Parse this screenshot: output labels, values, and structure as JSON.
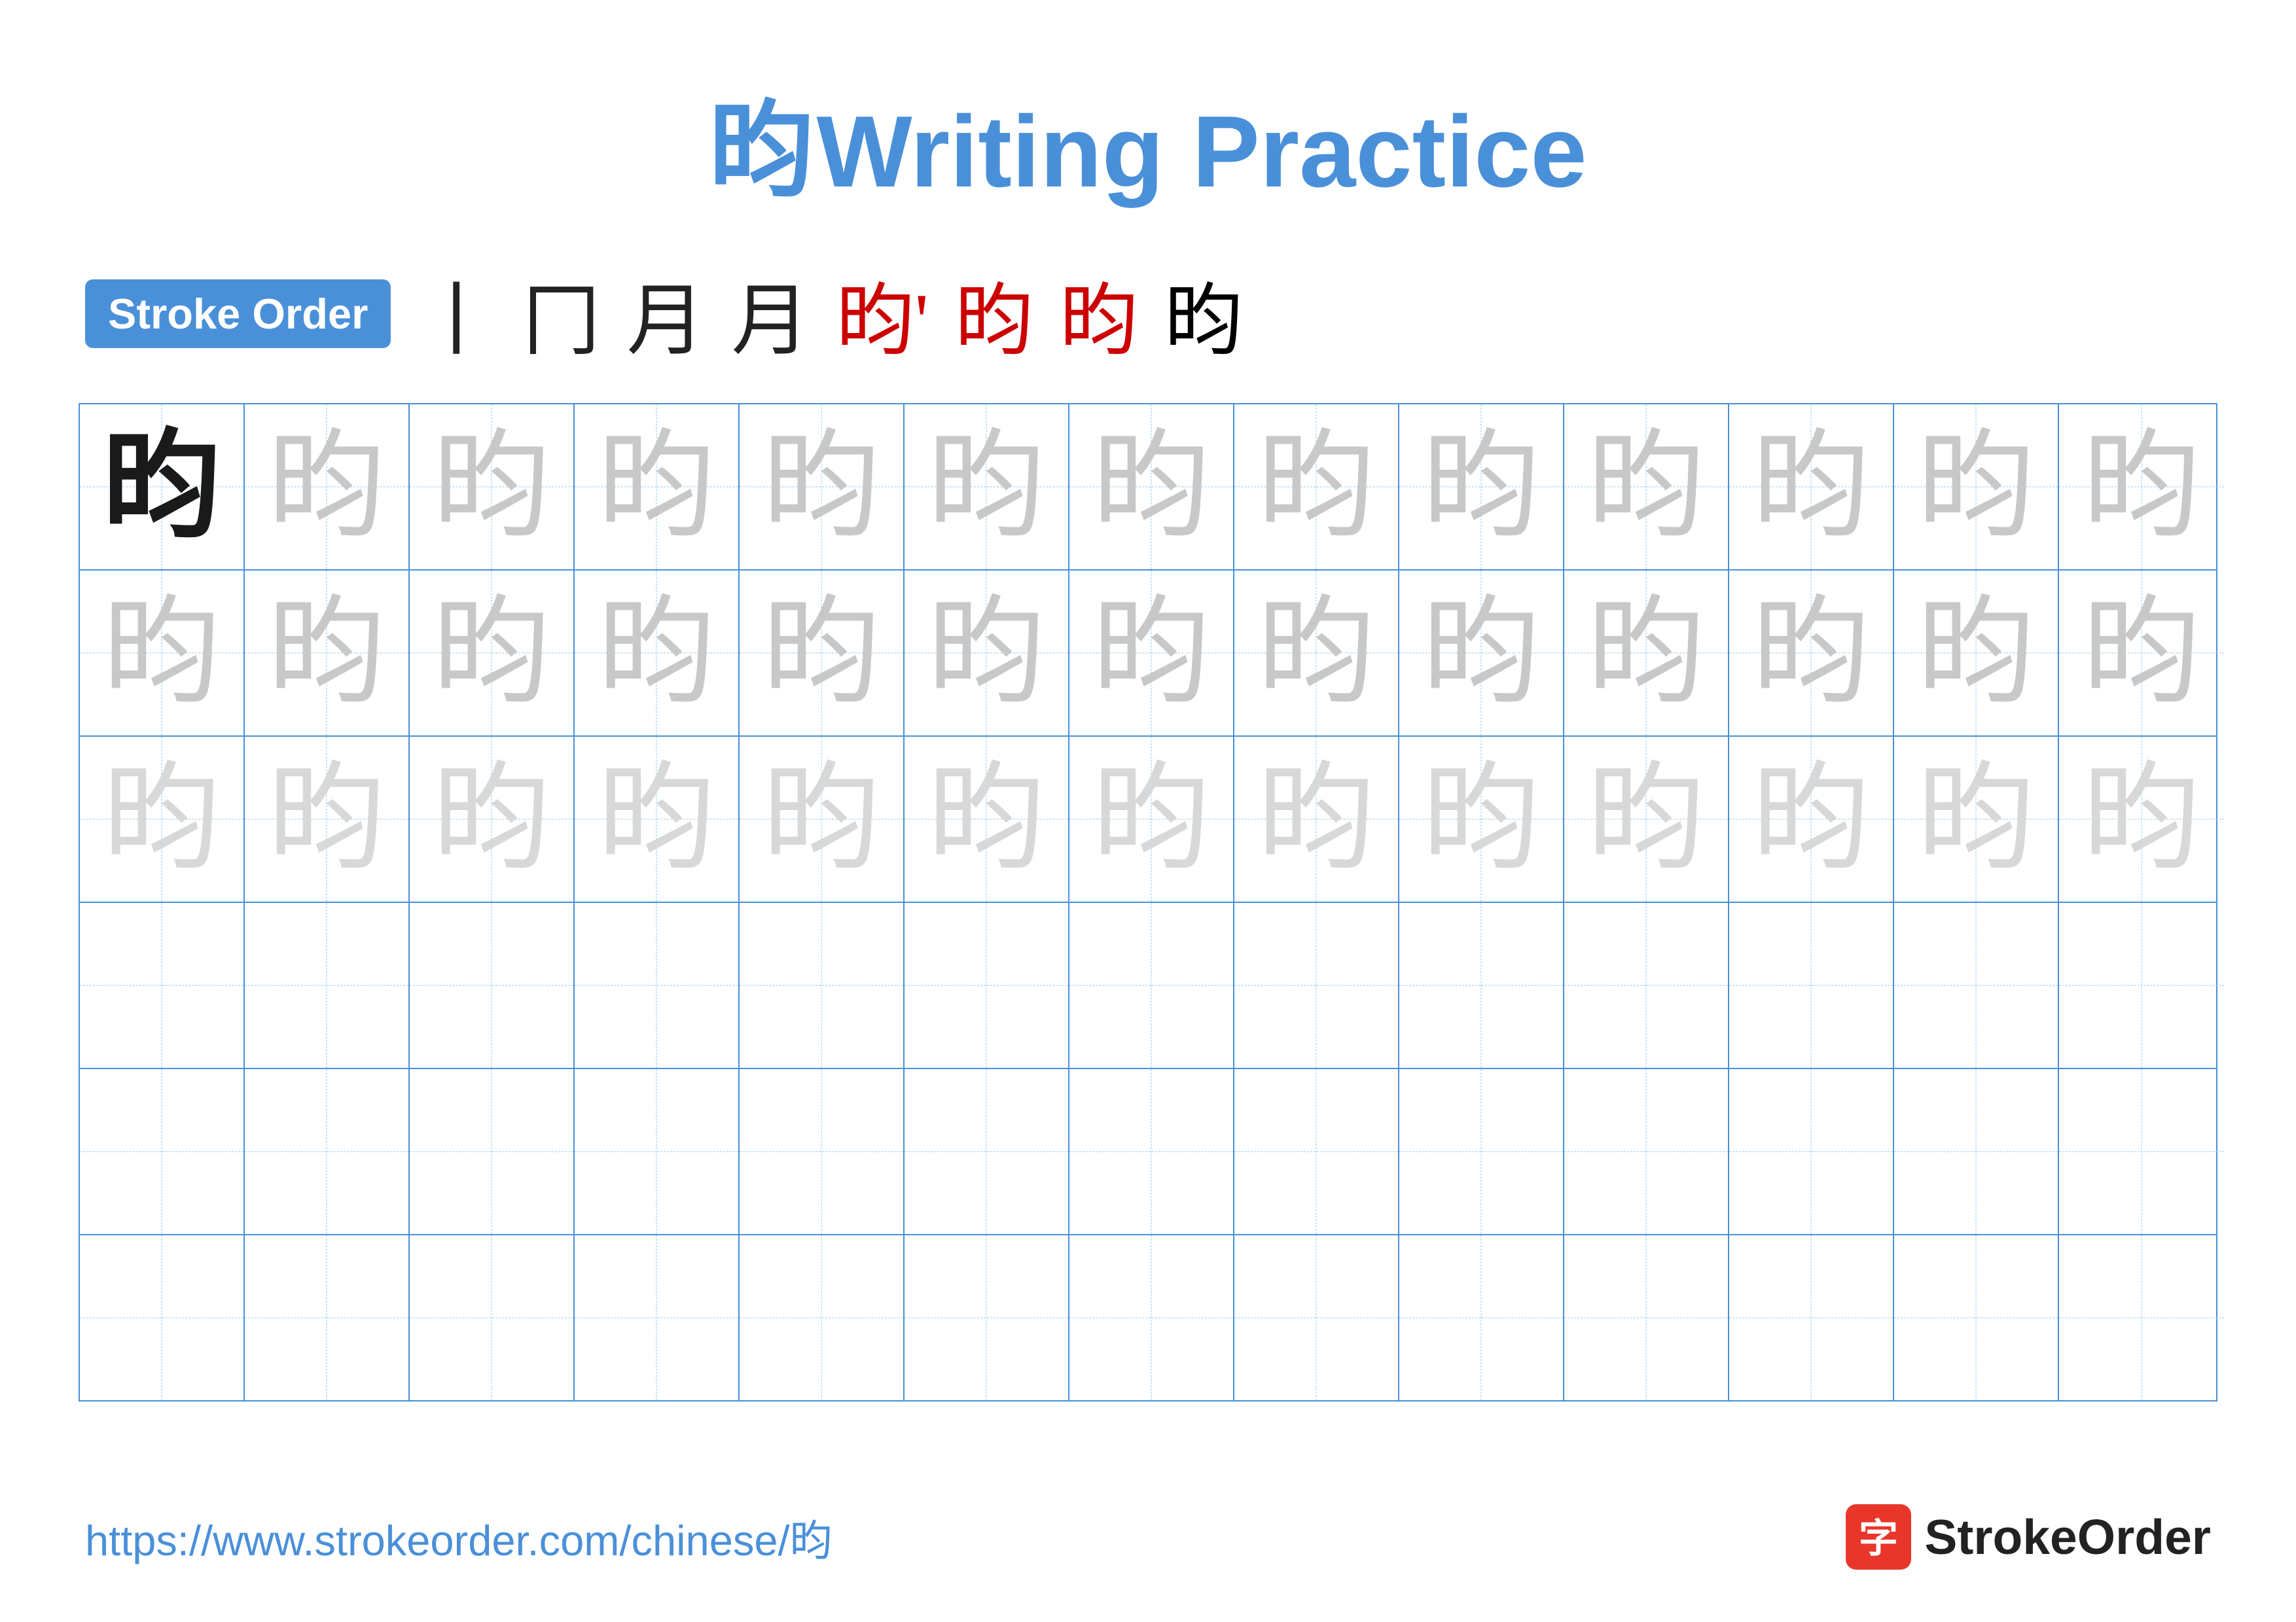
{
  "title": {
    "char": "昀",
    "text": "Writing Practice"
  },
  "stroke_order": {
    "badge": "Stroke Order",
    "steps": [
      "丨",
      "冂",
      "月",
      "月",
      "昀'",
      "昀",
      "昀",
      "昀"
    ]
  },
  "grid": {
    "rows": 6,
    "cols": 13,
    "char": "昀",
    "row_types": [
      "dark_then_light1",
      "light1",
      "light2",
      "empty",
      "empty",
      "empty"
    ]
  },
  "footer": {
    "url": "https://www.strokeorder.com/chinese/昀",
    "logo_text": "StrokeOrder"
  }
}
